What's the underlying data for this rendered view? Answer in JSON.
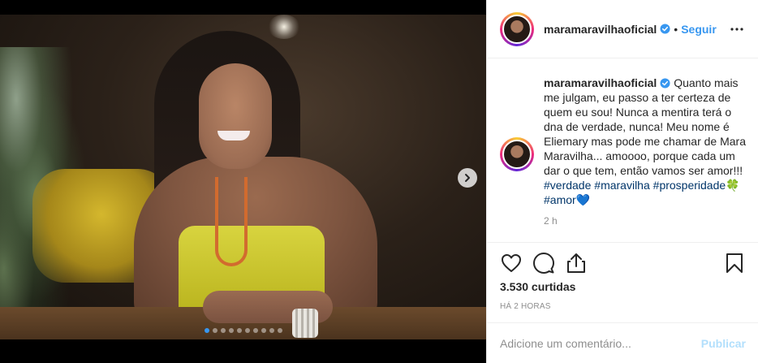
{
  "media": {
    "photo_subject": "woman-in-yellow-top",
    "carousel": {
      "dot_count": 10,
      "active_index": 0
    },
    "next_icon": "chevron-right-icon"
  },
  "header": {
    "username": "maramaravilhaoficial",
    "verified_icon": "verified-badge-icon",
    "separator": "•",
    "follow_label": "Seguir",
    "more_icon": "ellipsis-icon"
  },
  "caption": {
    "username": "maramaravilhaoficial",
    "text": "Quanto mais me julgam, eu passo a ter certeza de quem eu sou! Nunca a mentira terá o dna de verdade, nunca! Meu nome é Eliemary mas pode me chamar de Mara Maravilha... amoooo, porque cada um dar o que tem, então vamos ser amor!!!",
    "hashtags": [
      "#verdade",
      "#maravilha",
      "#prosperidade",
      "#amor"
    ],
    "emojis": [
      "🍀",
      "💙"
    ],
    "time": "2 h"
  },
  "actions": {
    "like_icon": "heart-icon",
    "comment_icon": "comment-icon",
    "share_icon": "share-icon",
    "save_icon": "bookmark-icon",
    "likes": "3.530 curtidas",
    "posted_ago": "HÁ 2 HORAS"
  },
  "comment": {
    "placeholder": "Adicione um comentário...",
    "post_label": "Publicar"
  },
  "colors": {
    "link_blue": "#3897f0",
    "hashtag": "#003569",
    "muted": "#8e8e8e",
    "post_disabled": "#b2dffc",
    "border": "#efefef"
  }
}
